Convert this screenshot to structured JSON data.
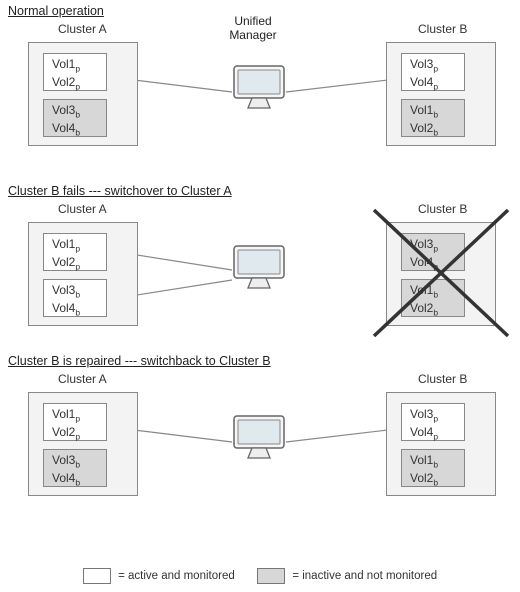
{
  "titles": {
    "s1": "Normal operation",
    "s2": "Cluster B fails --- switchover to Cluster A",
    "s3": "Cluster B is repaired --- switchback to Cluster B"
  },
  "labels": {
    "clusterA": "Cluster A",
    "clusterB": "Cluster B",
    "um1": "Unified",
    "um2": "Manager"
  },
  "vols": {
    "v1": "Vol1",
    "v1s": "p",
    "v2": "Vol2",
    "v2s": "p",
    "v3": "Vol3",
    "v3s": "b",
    "v4": "Vol4",
    "v4s": "b",
    "v3p": "Vol3",
    "v3ps": "p",
    "v4p": "Vol4",
    "v4ps": "p",
    "v1b": "Vol1",
    "v1bs": "b",
    "v2b": "Vol2",
    "v2bs": "b"
  },
  "legend": {
    "active": "= active and monitored",
    "inactive": "= inactive and not monitored"
  }
}
